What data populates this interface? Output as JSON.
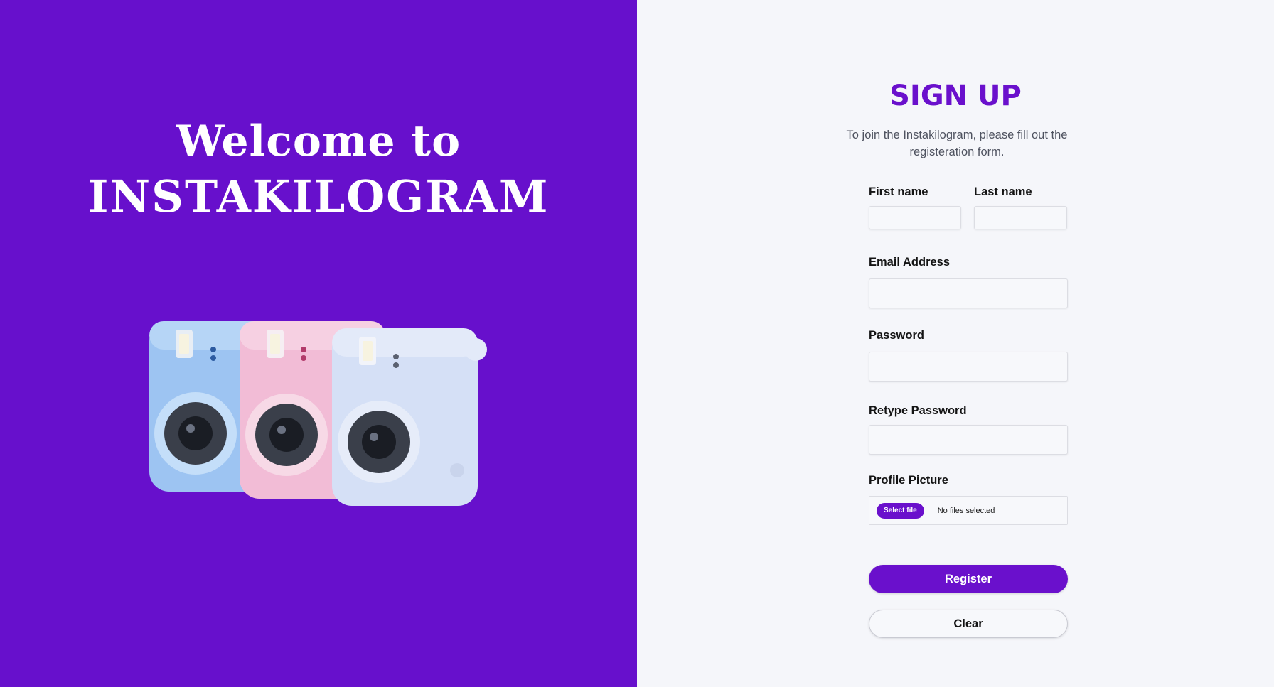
{
  "hero": {
    "line1": "Welcome to",
    "line2": "INSTAKILOGRAM",
    "image": "instant-cameras-illustration"
  },
  "signup": {
    "title": "SIGN UP",
    "subtitle": "To join the Instakilogram, please fill out the registeration form.",
    "first_name_label": "First name",
    "last_name_label": "Last name",
    "email_label": "Email Address",
    "password_label": "Password",
    "retype_password_label": "Retype Password",
    "profile_picture_label": "Profile Picture",
    "file_button_label": "Select file",
    "file_status": "No files selected",
    "register_label": "Register",
    "clear_label": "Clear",
    "first_name_value": "",
    "last_name_value": "",
    "email_value": "",
    "password_value": "",
    "retype_password_value": ""
  },
  "colors": {
    "accent": "#6a10cc",
    "background": "#f5f6fa",
    "hero_background": "#6710cc"
  }
}
